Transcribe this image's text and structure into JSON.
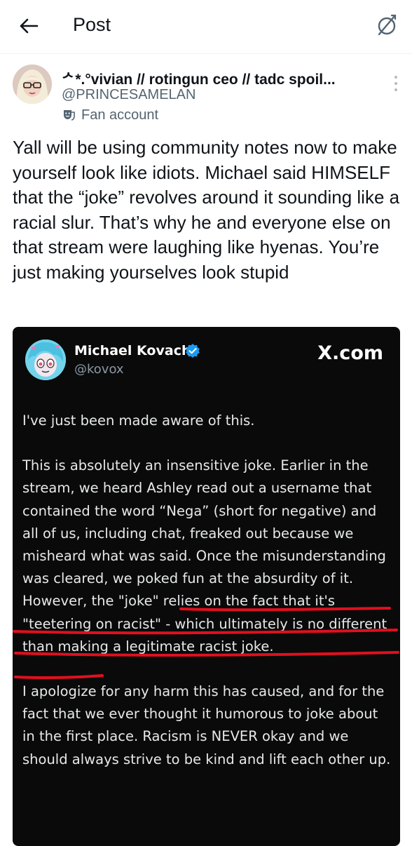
{
  "header": {
    "title": "Post"
  },
  "author": {
    "display_name": "ᄼ*.°vivian // rotingun ceo // tadc spoil...",
    "handle": "@PRINCESAMELAN",
    "badge_label": "Fan account"
  },
  "tweet": {
    "text": "Yall will be using community notes now to make yourself look like idiots. Michael said HIMSELF that the “joke” revolves around it sounding like a racial slur. That’s why he and everyone else on that stream were laughing like hyenas. You’re just making yourselves look stupid"
  },
  "embedded_screenshot": {
    "name": "Michael Kovach",
    "handle": "@kovox",
    "site": "X.com",
    "paragraphs": [
      "I've just been made aware of this.",
      "This is absolutely an insensitive joke. Earlier in the stream, we heard Ashley read out a username that contained the word “Nega” (short for negative) and all of us, including chat, freaked out because we misheard what was said. Once the misunderstanding was cleared, we poked fun at the absurdity of it. However, the \"joke\" relies on the fact that it's \"teetering on racist\" - which ultimately is no different than making a legitimate racist joke.",
      "I apologize for any harm this has caused, and for the fact that we ever thought it humorous to joke about in the first place. Racism is NEVER okay and we should always strive to be kind and lift each other up."
    ]
  },
  "icons": {
    "back": "arrow-left-icon",
    "mute": "circle-slash-icon",
    "more": "vertical-ellipsis-icon",
    "fan_badge": "theater-mask-icon",
    "verified": "verified-badge-icon"
  },
  "colors": {
    "underline_annotation": "#e0101f",
    "verified_blue": "#1d9bf0",
    "card_background": "#0a0a0a"
  }
}
